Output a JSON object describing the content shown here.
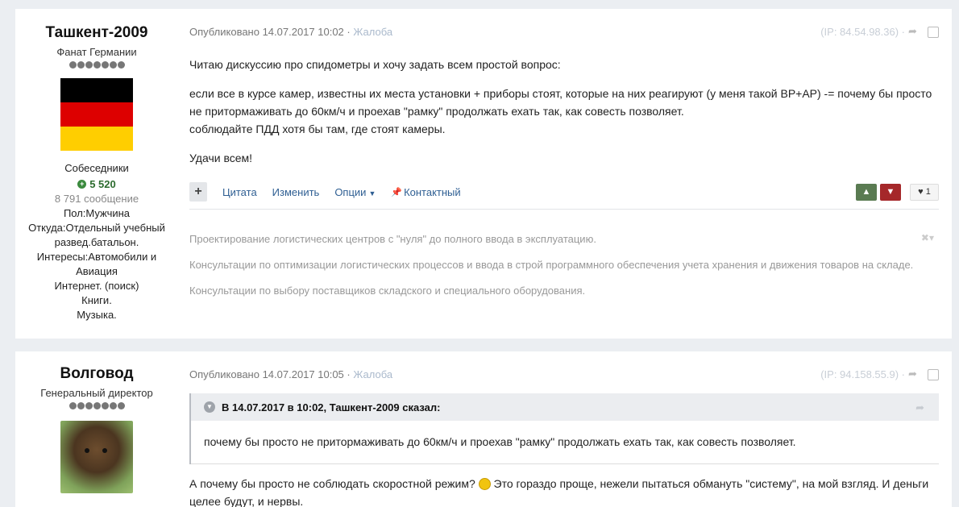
{
  "post1": {
    "author": {
      "name": "Ташкент-2009",
      "title": "Фанат Германии",
      "pips": 7,
      "group": "Собеседники",
      "reputation": "5 520",
      "posts": "8 791 сообщение",
      "gender": "Пол:Мужчина",
      "location_1": "Откуда:Отдельный учебный",
      "location_2": "развед.батальон.",
      "interests_1": "Интересы:Автомобили и",
      "interests_2": "Авиация",
      "interests_3": "Интернет. (поиск)",
      "interests_4": "Книги.",
      "interests_5": "Музыка.",
      "flag_colors": [
        "#000000",
        "#dd0000",
        "#ffce00"
      ]
    },
    "meta": "Опубликовано 14.07.2017 10:02 ·",
    "report": "Жалоба",
    "ip": "(IP: 84.54.98.36) ·",
    "paragraphs": [
      "Читаю дискуссию про спидометры и хочу задать всем простой вопрос:",
      "если все в курсе камер, известны их места установки + приборы стоят, которые на них реагируют (у меня такой BP+AP) -= почему бы просто",
      "не притормаживать до 60км/ч и проехав \"рамку\" продолжать ехать так, как совесть позволяет.",
      "соблюдайте ПДД хотя бы там, где стоят камеры.",
      "Удачи всем!"
    ],
    "actions": {
      "multiquote": "+",
      "quote": "Цитата",
      "edit": "Изменить",
      "options": "Опции",
      "contact": "Контактный"
    },
    "likes": "1",
    "signature": [
      "Проектирование логистических центров с \"нуля\" до полного ввода в эксплуатацию.",
      "Консультации по оптимизации логистических процессов и ввода в строй программного обеспечения учета хранения и движения товаров на складе.",
      "Консультации по выбору поставщиков складского и специального оборудования."
    ]
  },
  "post2": {
    "author": {
      "name": "Волговод",
      "title": "Генеральный директор",
      "pips": 7
    },
    "meta": "Опубликовано 14.07.2017 10:05 ·",
    "report": "Жалоба",
    "ip": "(IP: 94.158.55.9) ·",
    "quote_header": "В 14.07.2017 в 10:02, Ташкент-2009 сказал:",
    "quote_body": "почему бы просто не притормаживать до 60км/ч и проехав \"рамку\" продолжать ехать так, как совесть позволяет.",
    "text_1": "А почему бы просто не соблюдать скоростной режим?",
    "text_2": "Это гораздо проще, нежели пытаться обмануть \"систему\", на мой взгляд. И деньги",
    "text_3": "целее будут, и нервы."
  }
}
